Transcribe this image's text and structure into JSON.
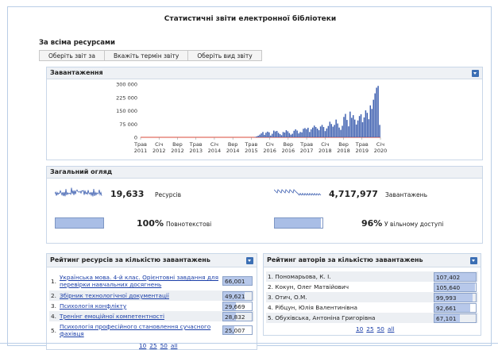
{
  "page": {
    "title": "Статистичні звіти електронної бібліотеки"
  },
  "resources": {
    "heading": "За всіма ресурсами",
    "tabs": [
      "Оберіть звіт за",
      "Вкажіть термін звіту",
      "Оберіть вид звіту"
    ]
  },
  "downloads_panel": {
    "title": "Завантаження",
    "chart_data": {
      "type": "bar",
      "y_ticks": [
        "300 000",
        "225 000",
        "150 000",
        "75 000",
        "0"
      ],
      "ylim": [
        0,
        300000
      ],
      "x_labels": [
        [
          "Трав",
          "2011"
        ],
        [
          "Січ",
          "2012"
        ],
        [
          "Вер",
          "2012"
        ],
        [
          "Трав",
          "2013"
        ],
        [
          "Січ",
          "2014"
        ],
        [
          "Вер",
          "2014"
        ],
        [
          "Трав",
          "2015"
        ],
        [
          "Січ",
          "2016"
        ],
        [
          "Вер",
          "2016"
        ],
        [
          "Трав",
          "2017"
        ],
        [
          "Січ",
          "2018"
        ],
        [
          "Вер",
          "2018"
        ],
        [
          "Трав",
          "2019"
        ],
        [
          "Січ",
          "2020"
        ]
      ],
      "values": [
        0,
        0,
        0,
        0,
        0,
        0,
        0,
        0,
        0,
        0,
        0,
        0,
        0,
        0,
        0,
        0,
        0,
        0,
        0,
        0,
        0,
        0,
        0,
        0,
        0,
        0,
        0,
        0,
        0,
        0,
        0,
        0,
        0,
        0,
        0,
        0,
        0,
        0,
        0,
        0,
        0,
        0,
        0,
        0,
        0,
        0,
        0,
        0,
        0,
        0,
        0,
        0,
        0,
        0,
        0,
        0,
        0,
        0,
        0,
        0,
        0,
        0,
        0,
        0,
        0,
        0,
        0,
        0,
        0,
        0,
        0,
        0,
        0,
        2000,
        5000,
        9000,
        15000,
        22000,
        30000,
        14000,
        26000,
        32000,
        28000,
        10000,
        20000,
        38000,
        33000,
        36000,
        25000,
        18000,
        12000,
        30000,
        27000,
        40000,
        34000,
        24000,
        15000,
        20000,
        37000,
        45000,
        38000,
        22000,
        30000,
        28000,
        48000,
        52000,
        46000,
        54000,
        30000,
        45000,
        55000,
        66000,
        58000,
        49000,
        40000,
        61000,
        70000,
        58000,
        35000,
        50000,
        64000,
        88000,
        75000,
        60000,
        70000,
        100000,
        78000,
        55000,
        42000,
        65000,
        115000,
        132000,
        98000,
        62000,
        145000,
        110000,
        125000,
        100000,
        72000,
        95000,
        120000,
        130000,
        85000,
        112000,
        152000,
        138000,
        102000,
        180000,
        160000,
        212000,
        248000,
        280000,
        290000,
        70000
      ]
    }
  },
  "overview": {
    "title": "Загальний огляд",
    "resources_value": "19,633",
    "resources_label": "Ресурсів",
    "downloads_value": "4,717,977",
    "downloads_label": "Завантажень",
    "fulltext_value": "100%",
    "fulltext_label": "Повнотекстові",
    "fulltext_fraction": 1.0,
    "open_value": "96%",
    "open_label": "У вільному доступі",
    "open_fraction": 0.96
  },
  "resource_rating": {
    "title": "Рейтинг ресурсів за кількістю завантажень",
    "rows": [
      {
        "n": "1.",
        "title": "Українська мова. 4-й клас. Орієнтовні завдання для перевірки навчальних досягнень",
        "value": "66,001",
        "fraction": 1.0
      },
      {
        "n": "2.",
        "title": "Збірник технологічної документації",
        "value": "49,621",
        "fraction": 0.75
      },
      {
        "n": "3.",
        "title": "Психологія конфлікту",
        "value": "29,669",
        "fraction": 0.45
      },
      {
        "n": "4.",
        "title": "Тренінг емоційної компетентності",
        "value": "28,832",
        "fraction": 0.44
      },
      {
        "n": "5.",
        "title": "Психологія професійного становлення сучасного фахівця",
        "value": "25,007",
        "fraction": 0.38
      }
    ],
    "pager": [
      "10",
      "25",
      "50",
      "all"
    ]
  },
  "author_rating": {
    "title": "Рейтинг авторів за кількістю завантажень",
    "rows": [
      {
        "n": "1.",
        "name": "Пономарьова, К. І.",
        "value": "107,402",
        "fraction": 1.0
      },
      {
        "n": "2.",
        "name": "Кокун, Олег Матвійович",
        "value": "105,640",
        "fraction": 0.98
      },
      {
        "n": "3.",
        "name": "Отич, О.М.",
        "value": "99,993",
        "fraction": 0.93
      },
      {
        "n": "4.",
        "name": "Рібцун, Юлія Валентинівна",
        "value": "92,661",
        "fraction": 0.86
      },
      {
        "n": "5.",
        "name": "Обухівська, Антоніна Григорівна",
        "value": "67,101",
        "fraction": 0.62
      }
    ],
    "pager": [
      "10",
      "25",
      "50",
      "all"
    ]
  },
  "colors": {
    "accent": "#3c6fb4",
    "bar": "#3d5fb0",
    "zero_line": "#d84a3a",
    "panel_head": "#eef1f5"
  }
}
